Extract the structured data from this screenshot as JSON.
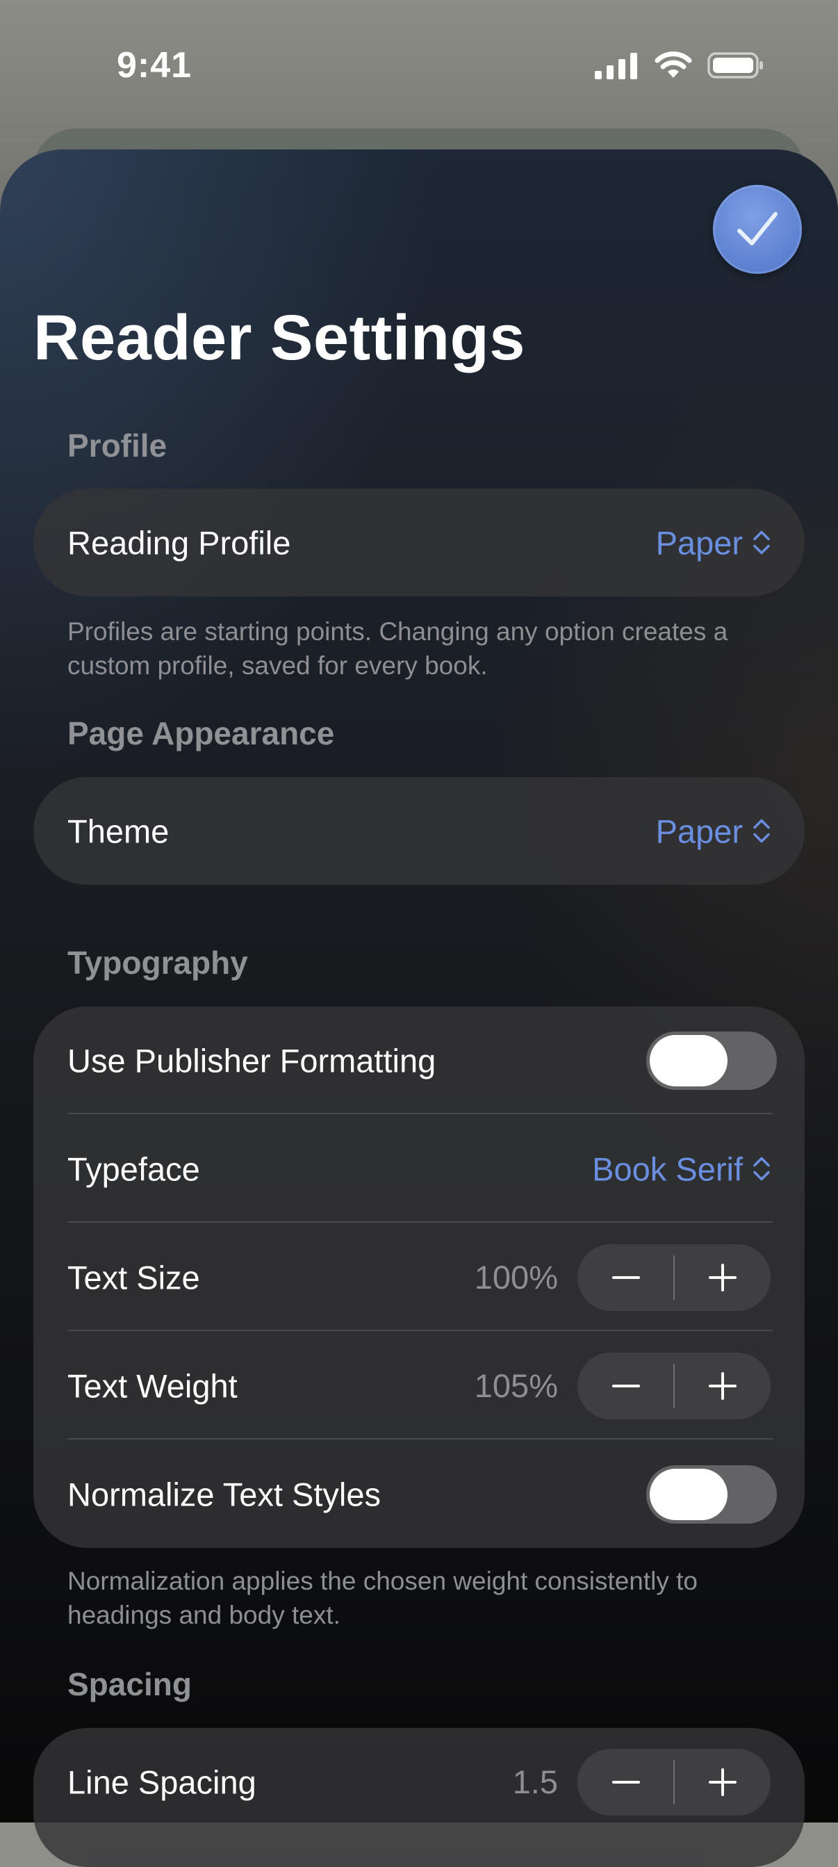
{
  "status_bar": {
    "time": "9:41"
  },
  "header": {
    "title": "Reader Settings",
    "done_icon": "checkmark-icon",
    "accent_color": "#5d80cf"
  },
  "sections": {
    "profile": {
      "header": "Profile",
      "reading_profile": {
        "label": "Reading Profile",
        "value": "Paper"
      },
      "footnote": "Profiles are starting points. Changing any option creates a custom profile, saved for every book."
    },
    "page_appearance": {
      "header": "Page Appearance",
      "theme": {
        "label": "Theme",
        "value": "Paper"
      }
    },
    "typography": {
      "header": "Typography",
      "publisher_formatting": {
        "label": "Use Publisher Formatting",
        "on": false
      },
      "typeface": {
        "label": "Typeface",
        "value": "Book Serif"
      },
      "text_size": {
        "label": "Text Size",
        "value": "100%"
      },
      "text_weight": {
        "label": "Text Weight",
        "value": "105%"
      },
      "normalize": {
        "label": "Normalize Text Styles",
        "on": false
      },
      "footnote": "Normalization applies the chosen weight consistently to headings and body text."
    },
    "spacing": {
      "header": "Spacing",
      "line_spacing": {
        "label": "Line Spacing",
        "value": "1.5"
      }
    }
  },
  "colors": {
    "value_link": "#6b8fe0",
    "card_background": "#343437",
    "toggle_off": "#636366"
  }
}
